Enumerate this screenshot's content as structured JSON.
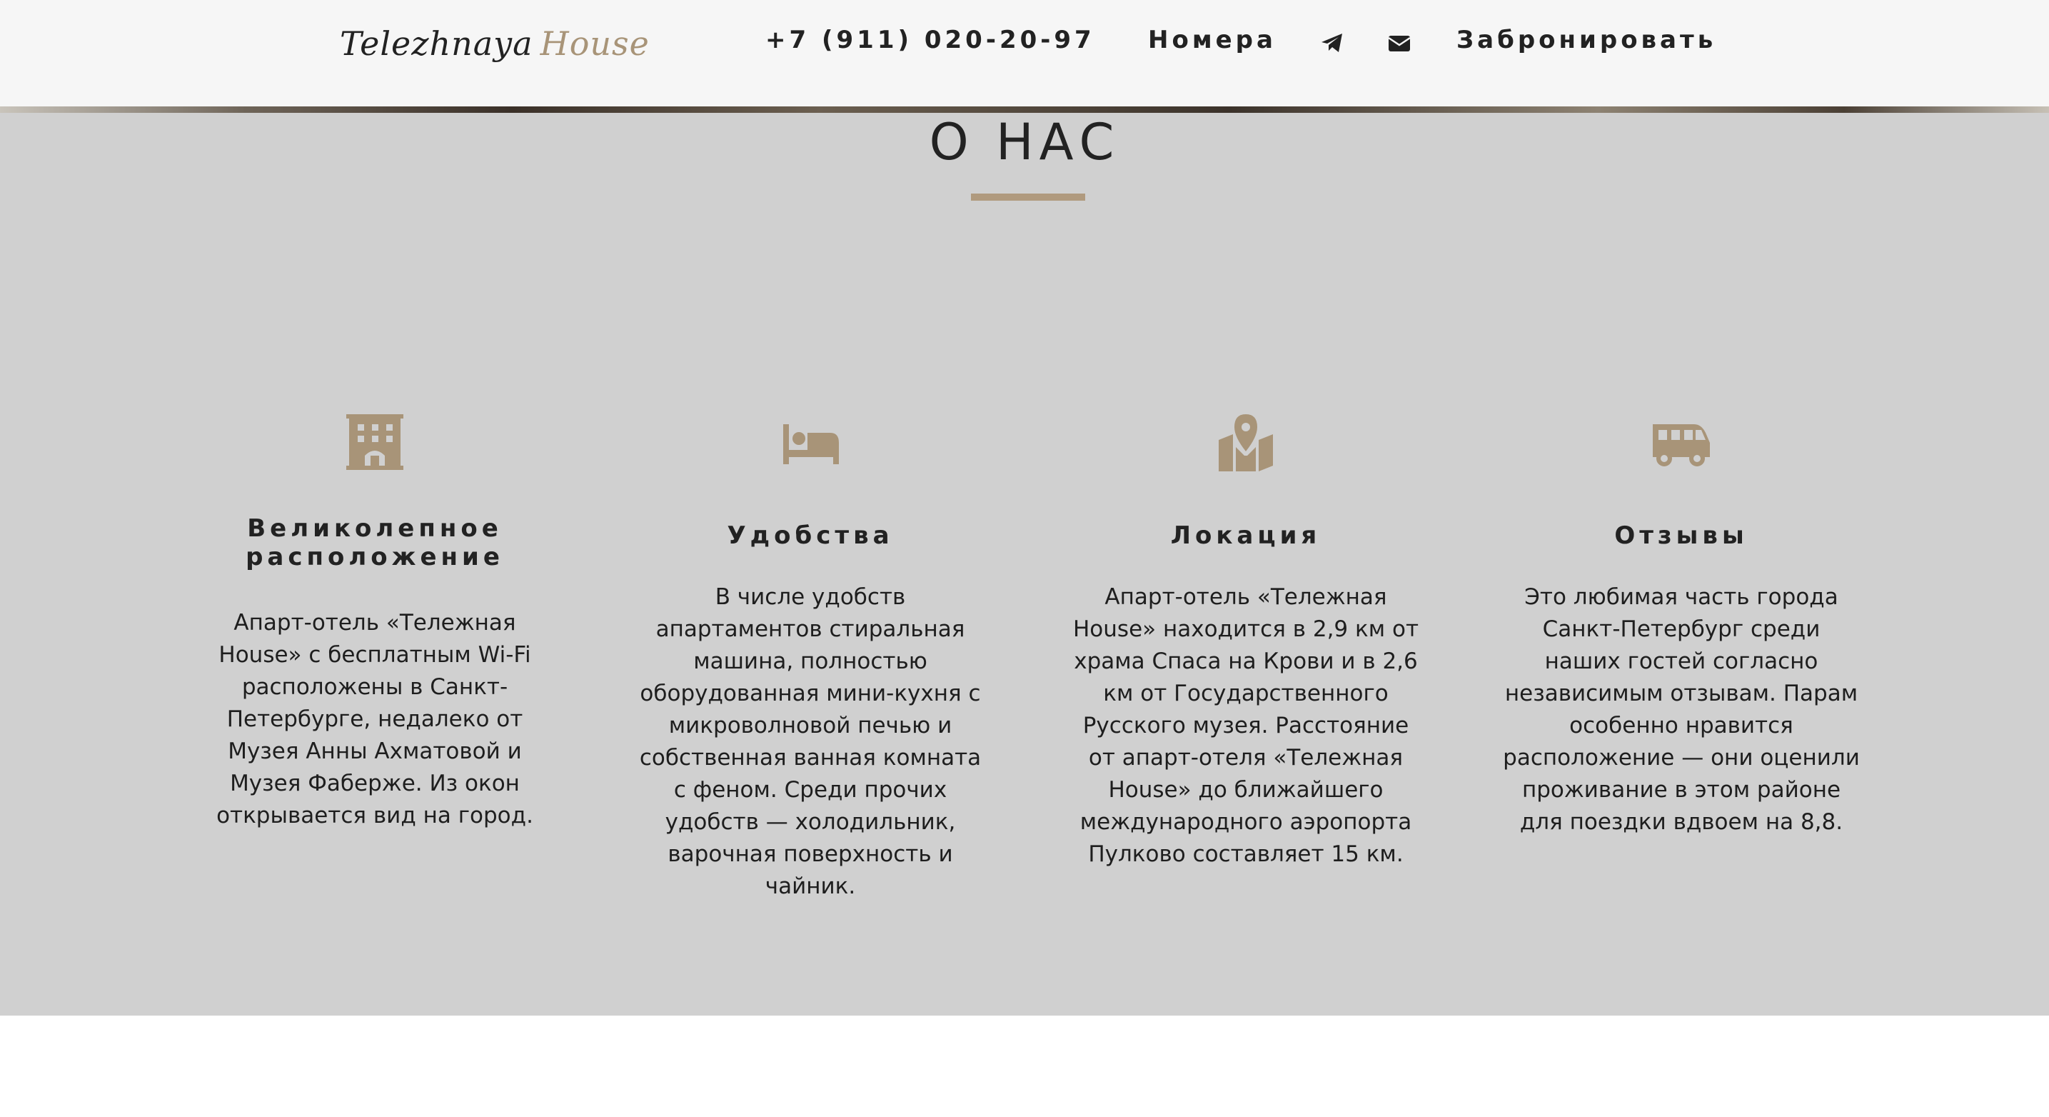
{
  "header": {
    "logo": {
      "part1": "Telezhnaya",
      "part2": "House"
    },
    "phone": "+7 (911) 020-20-97",
    "rooms_link": "Номера",
    "telegram_icon": "telegram-icon",
    "email_icon": "envelope-icon",
    "book_link": "Забронировать"
  },
  "about": {
    "title": "О НАС",
    "features": [
      {
        "icon": "hotel-building-icon",
        "title": "Великолепное расположение",
        "text": "Апарт-отель «Тележная House» с бесплатным Wi-Fi расположены в Санкт-Петербурге, недалеко от Музея Анны Ахматовой и Музея Фаберже. Из окон открывается вид на город."
      },
      {
        "icon": "bed-icon",
        "title": "Удобства",
        "text": "В числе удобств апартаментов стиральная машина, полностью оборудованная мини-кухня с микроволновой печью и собственная ванная комната с феном. Среди прочих удобств — холодильник, варочная поверхность и чайник."
      },
      {
        "icon": "map-marker-icon",
        "title": "Локация",
        "text": "Апарт-отель «Тележная House» находится в 2,9 км от храма Спаса на Крови и в 2,6 км от Государственного Русского музея. Расстояние от апарт-отеля «Тележная House» до ближайшего международного аэропорта Пулково составляет 15 км."
      },
      {
        "icon": "shuttle-van-icon",
        "title": "Отзывы",
        "text": "Это любимая часть города Санкт-Петербург среди наших гостей согласно независимым отзывам. Парам особенно нравится расположение — они оценили проживание в этом районе для поездки вдвоем на 8,8."
      }
    ]
  },
  "colors": {
    "accent": "#b09a7e",
    "section_bg": "#d0d0d0",
    "navbar_bg": "#f6f6f6",
    "text": "#222222"
  }
}
